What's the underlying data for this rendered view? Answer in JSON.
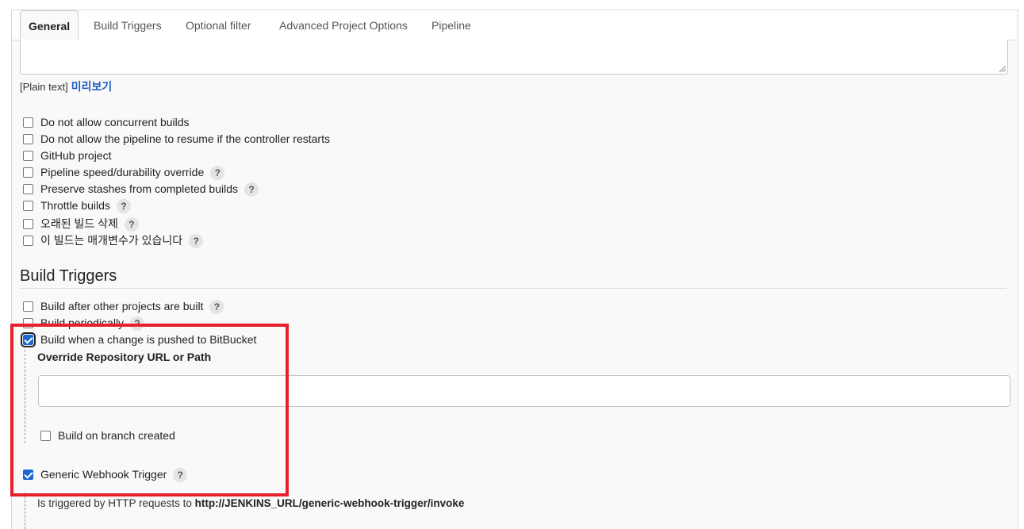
{
  "tabs": [
    {
      "label": "General",
      "active": true
    },
    {
      "label": "Build Triggers",
      "active": false
    },
    {
      "label": "Optional filter",
      "active": false
    },
    {
      "label": "Advanced Project Options",
      "active": false
    },
    {
      "label": "Pipeline",
      "active": false
    }
  ],
  "description": {
    "value": "",
    "format_label": "[Plain text]",
    "preview_link": "미리보기"
  },
  "general_options": [
    {
      "label": "Do not allow concurrent builds",
      "checked": false,
      "help": false
    },
    {
      "label": "Do not allow the pipeline to resume if the controller restarts",
      "checked": false,
      "help": false
    },
    {
      "label": "GitHub project",
      "checked": false,
      "help": false
    },
    {
      "label": "Pipeline speed/durability override",
      "checked": false,
      "help": true
    },
    {
      "label": "Preserve stashes from completed builds",
      "checked": false,
      "help": true
    },
    {
      "label": "Throttle builds",
      "checked": false,
      "help": true
    },
    {
      "label": "오래된 빌드 삭제",
      "checked": false,
      "help": true
    },
    {
      "label": "이 빌드는 매개변수가 있습니다",
      "checked": false,
      "help": true
    }
  ],
  "build_triggers": {
    "title": "Build Triggers",
    "options": [
      {
        "label": "Build after other projects are built",
        "checked": false,
        "help": true
      },
      {
        "label": "Build periodically",
        "checked": false,
        "help": true
      },
      {
        "label": "Build when a change is pushed to BitBucket",
        "checked": true,
        "help": false
      }
    ],
    "override_label": "Override Repository URL or Path",
    "override_value": "",
    "branch_created_label": "Build on branch created",
    "branch_created_checked": false,
    "generic_webhook_label": "Generic Webhook Trigger",
    "generic_webhook_checked": true,
    "webhook_info_prefix": "Is triggered by HTTP requests to",
    "webhook_info_url": "http://JENKINS_URL/generic-webhook-trigger/invoke"
  },
  "help_symbol": "?",
  "colors": {
    "link": "#1a5dc1",
    "checkbox_checked": "#1a66d2",
    "highlight_box": "#e8202b"
  }
}
